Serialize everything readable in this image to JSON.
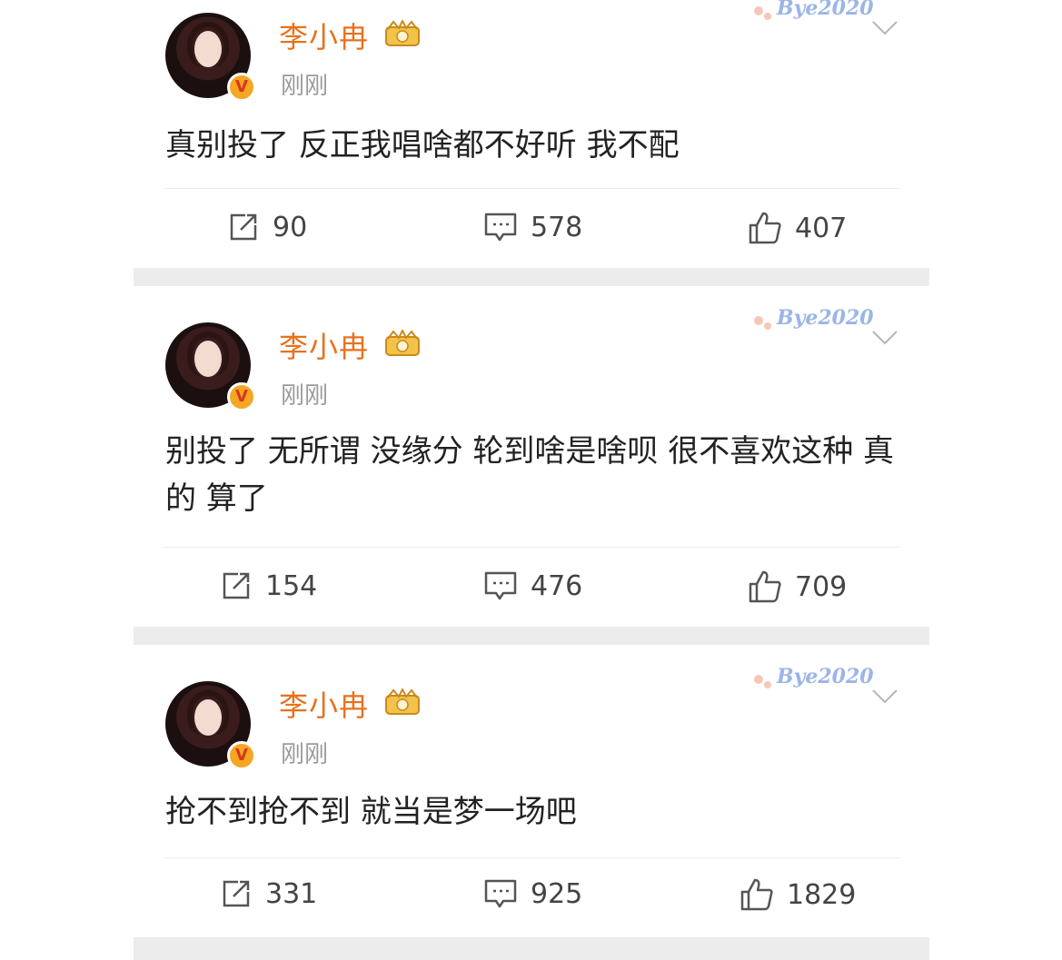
{
  "posts": [
    {
      "author": "李小冉",
      "time": "刚刚",
      "decoration": "Bye2020",
      "text": "真别投了 反正我唱啥都不好听 我不配",
      "reposts": "90",
      "comments": "578",
      "likes": "407"
    },
    {
      "author": "李小冉",
      "time": "刚刚",
      "decoration": "Bye2020",
      "text": "别投了 无所谓 没缘分 轮到啥是啥呗 很不喜欢这种 真的  算了",
      "reposts": "154",
      "comments": "476",
      "likes": "709"
    },
    {
      "author": "李小冉",
      "time": "刚刚",
      "decoration": "Bye2020",
      "text": "抢不到抢不到 就当是梦一场吧",
      "reposts": "331",
      "comments": "925",
      "likes": "1829"
    }
  ],
  "colors": {
    "author": "#e8711c",
    "separator": "#ececec",
    "badge": "#f5a623"
  },
  "icons": [
    "repost-icon",
    "comment-icon",
    "like-icon",
    "chevron-down-icon",
    "verified-badge-icon",
    "crown-icon"
  ]
}
